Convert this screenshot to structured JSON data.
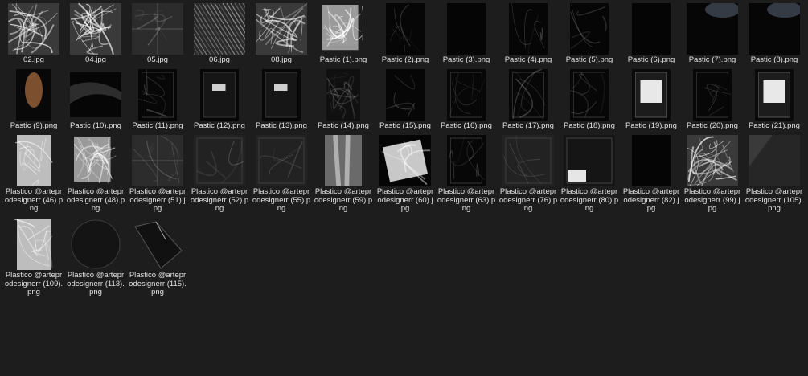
{
  "files": [
    {
      "name": "02.jpg",
      "thumb": "wrinkle-light"
    },
    {
      "name": "04.jpg",
      "thumb": "wrinkle-light"
    },
    {
      "name": "05.jpg",
      "thumb": "grid-grey"
    },
    {
      "name": "06.jpg",
      "thumb": "wrinkle-diag"
    },
    {
      "name": "08.jpg",
      "thumb": "wrinkle-light"
    },
    {
      "name": "Pastic (1).png",
      "thumb": "bright-foil"
    },
    {
      "name": "Pastic (2).png",
      "thumb": "dark-streak"
    },
    {
      "name": "Pastic (3).png",
      "thumb": "dark"
    },
    {
      "name": "Pastic (4).png",
      "thumb": "dark-streak"
    },
    {
      "name": "Pastic (5).png",
      "thumb": "dark-streak"
    },
    {
      "name": "Pastic (6).png",
      "thumb": "dark"
    },
    {
      "name": "Pastic (7).png",
      "thumb": "dark-glow"
    },
    {
      "name": "Pastic (8).png",
      "thumb": "dark-glow"
    },
    {
      "name": "Pastic (9).png",
      "thumb": "orange-glow"
    },
    {
      "name": "Pastic (10).png",
      "thumb": "dark-drape"
    },
    {
      "name": "Pastic (11).png",
      "thumb": "bag-dark"
    },
    {
      "name": "Pastic (12).png",
      "thumb": "bag-label"
    },
    {
      "name": "Pastic (13).png",
      "thumb": "bag-label"
    },
    {
      "name": "Pastic (14).png",
      "thumb": "dark-wrinkle"
    },
    {
      "name": "Pastic (15).png",
      "thumb": "dark-streak"
    },
    {
      "name": "Pastic (16).png",
      "thumb": "bag-dark"
    },
    {
      "name": "Pastic (17).png",
      "thumb": "bag-dark"
    },
    {
      "name": "Pastic (18).png",
      "thumb": "bag-dark"
    },
    {
      "name": "Pastic (19).png",
      "thumb": "bag-white-label"
    },
    {
      "name": "Pastic (20).png",
      "thumb": "bag-dark"
    },
    {
      "name": "Pastic (21).png",
      "thumb": "bag-white-label"
    },
    {
      "name": "Plastico @arteprodesignerr (46).png",
      "thumb": "bright-bag"
    },
    {
      "name": "Plastico @arteprodesignerr (48).png",
      "thumb": "bright-foil"
    },
    {
      "name": "Plastico @arteprodesignerr (51).jpg",
      "thumb": "grid-grey"
    },
    {
      "name": "Plastico @arteprodesignerr (52).png",
      "thumb": "faint"
    },
    {
      "name": "Plastico @arteprodesignerr (55).png",
      "thumb": "faint"
    },
    {
      "name": "Plastico @arteprodesignerr (59).png",
      "thumb": "legs"
    },
    {
      "name": "Plastico @arteprodesignerr (60).jpg",
      "thumb": "tilted-bag"
    },
    {
      "name": "Plastico @arteprodesignerr (63).png",
      "thumb": "bag-dark"
    },
    {
      "name": "Plastico @arteprodesignerr (76).png",
      "thumb": "faint"
    },
    {
      "name": "Plastico @arteprodesignerr (80).png",
      "thumb": "bag-corner-label"
    },
    {
      "name": "Plastico @arteprodesignerr (82).jpg",
      "thumb": "dark"
    },
    {
      "name": "Plastico @arteprodesignerr (99).jpg",
      "thumb": "wrinkle-light"
    },
    {
      "name": "Plastico @arteprodesignerr (105).png",
      "thumb": "faint-corner"
    },
    {
      "name": "Plastico @arteprodesignerr (109).png",
      "thumb": "bright-bag"
    },
    {
      "name": "Plastico @arteprodesignerr (113).png",
      "thumb": "circle"
    },
    {
      "name": "Plastico @arteprodesignerr (115).png",
      "thumb": "fold"
    }
  ]
}
